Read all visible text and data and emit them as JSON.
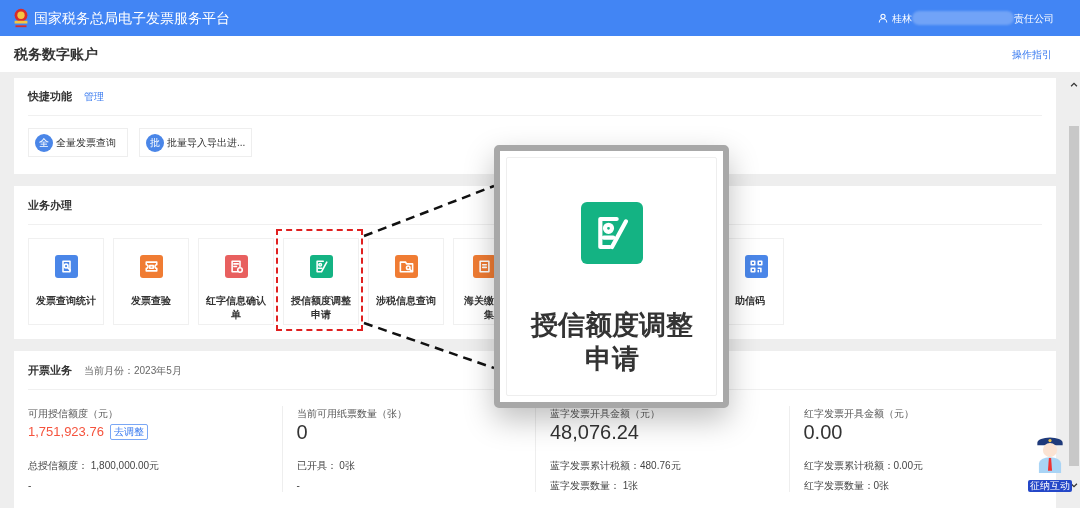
{
  "header": {
    "title": "国家税务总局电子发票服务平台",
    "user_prefix": "桂林",
    "user_suffix": "责任公司"
  },
  "page": {
    "title": "税务数字账户",
    "guide_link": "操作指引"
  },
  "shortcuts": {
    "title": "快捷功能",
    "manage_link": "管理",
    "items": [
      {
        "badge": "全",
        "label": "全量发票查询"
      },
      {
        "badge": "批",
        "label": "批量导入导出进..."
      }
    ]
  },
  "business": {
    "title": "业务办理",
    "tiles": [
      {
        "lines": [
          "发票查询统计"
        ],
        "color": "#4a86e8"
      },
      {
        "lines": [
          "发票查验"
        ],
        "color": "#f07c33"
      },
      {
        "lines": [
          "红字信息确认",
          "单"
        ],
        "color": "#e8605f"
      },
      {
        "lines": [
          "授信额度调整",
          "申请"
        ],
        "color": "#14b383"
      },
      {
        "lines": [
          "涉税信息查询"
        ],
        "color": "#f07c33"
      },
      {
        "lines": [
          "海关缴",
          "集"
        ],
        "color": "#f07c33"
      },
      {
        "lines": [
          "助信码"
        ],
        "color": "#4a86e8"
      }
    ]
  },
  "invoicing": {
    "title": "开票业务",
    "month": "当前月份：2023年5月",
    "stats": [
      {
        "label": "可用授信额度（元）",
        "value": "1,751,923.76",
        "color": "#f5533d",
        "action": "去调整",
        "lines": [
          "总授信额度： 1,800,000.00元",
          "-"
        ]
      },
      {
        "label": "当前可用纸票数量（张）",
        "value": "0",
        "color": "#333333",
        "lines": [
          "已开具： 0张",
          "-"
        ]
      },
      {
        "label": "蓝字发票开具金额（元）",
        "value": "48,076.24",
        "color": "#333333",
        "lines": [
          "蓝字发票累计税额：480.76元",
          "蓝字发票数量： 1张"
        ]
      },
      {
        "label": "红字发票开具金额（元）",
        "value": "0.00",
        "color": "#333333",
        "lines": [
          "红字发票累计税额：0.00元",
          "红字发票数量：0张"
        ]
      }
    ]
  },
  "callout": {
    "lines": [
      "授信额度调整",
      "申请"
    ],
    "color": "#14b383"
  },
  "mascot": {
    "badge": "征纳互动"
  }
}
